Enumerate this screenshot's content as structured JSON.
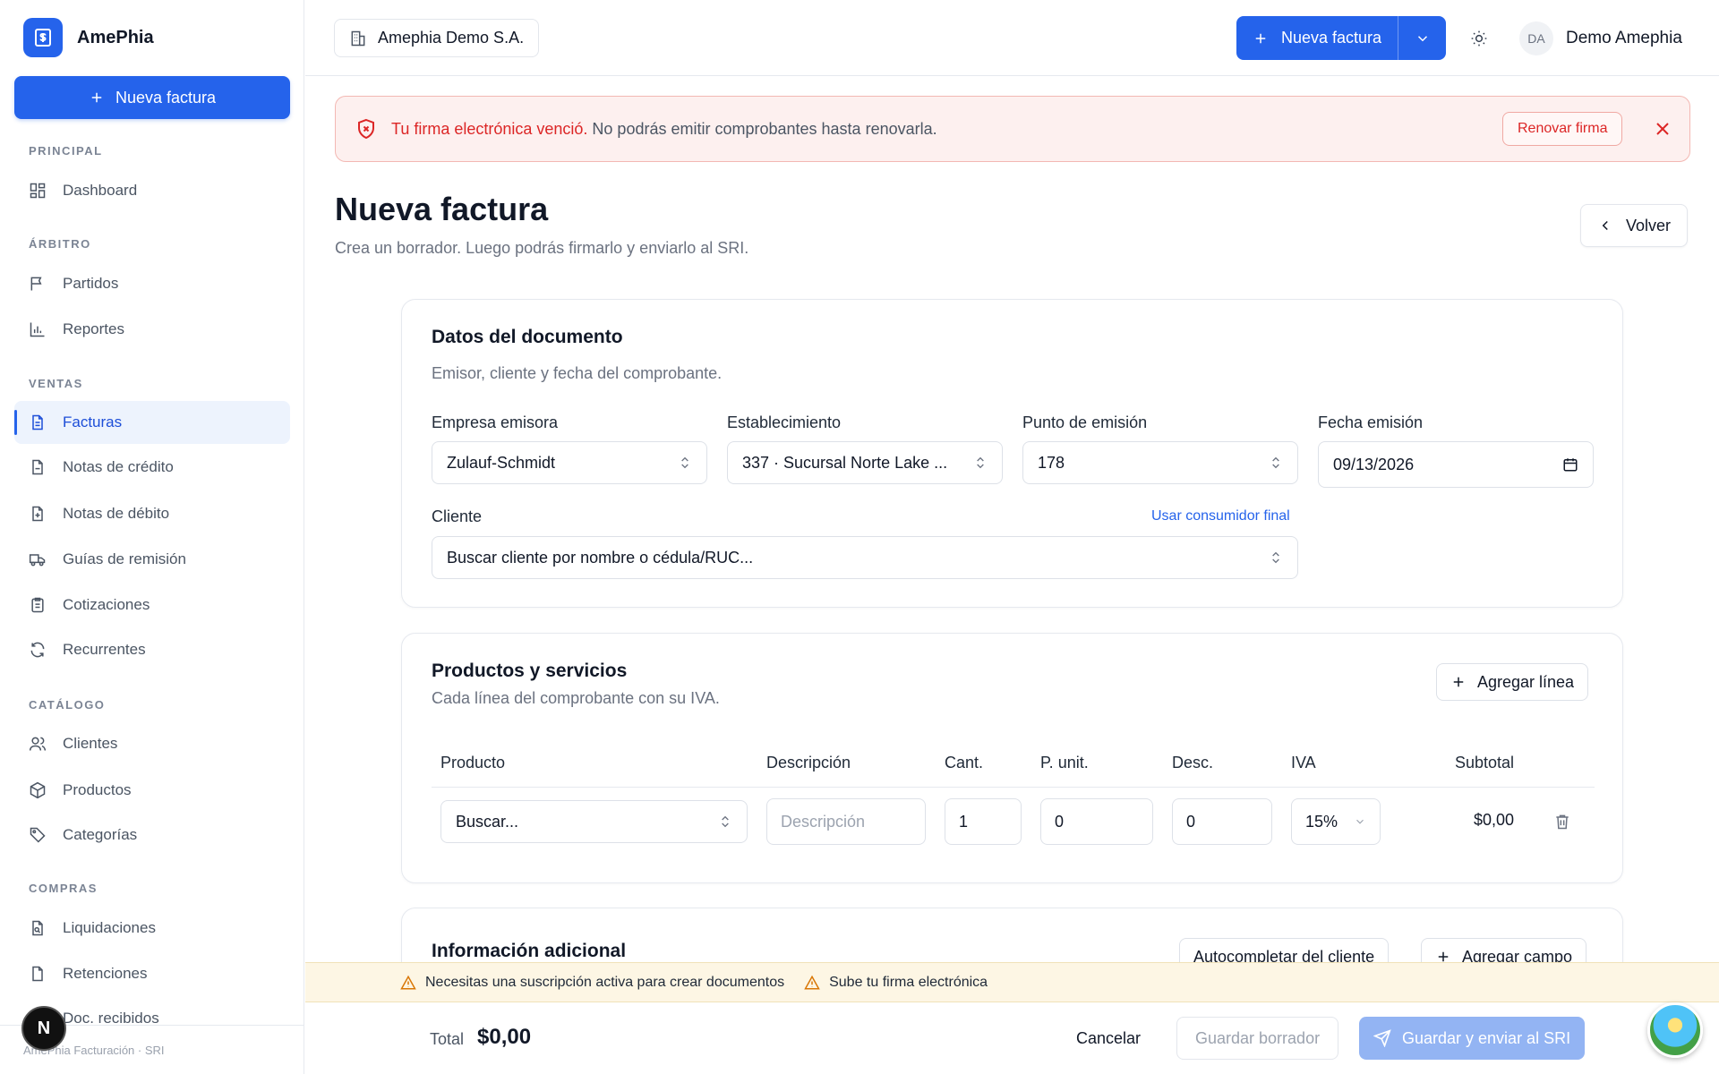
{
  "app": {
    "name": "AmePhia",
    "footer": "AmePhia Facturación · SRI"
  },
  "sidebar": {
    "cta": "Nueva factura",
    "sections": [
      {
        "title": "PRINCIPAL",
        "items": [
          {
            "label": "Dashboard",
            "icon": "grid-icon"
          }
        ]
      },
      {
        "title": "ÁRBITRO",
        "items": [
          {
            "label": "Partidos",
            "icon": "flag-icon"
          },
          {
            "label": "Reportes",
            "icon": "bar-chart-icon"
          }
        ]
      },
      {
        "title": "VENTAS",
        "items": [
          {
            "label": "Facturas",
            "icon": "document-icon",
            "active": true
          },
          {
            "label": "Notas de crédito",
            "icon": "file-minus-icon"
          },
          {
            "label": "Notas de débito",
            "icon": "file-plus-icon"
          },
          {
            "label": "Guías de remisión",
            "icon": "truck-icon"
          },
          {
            "label": "Cotizaciones",
            "icon": "clipboard-icon"
          },
          {
            "label": "Recurrentes",
            "icon": "refresh-icon"
          }
        ]
      },
      {
        "title": "CATÁLOGO",
        "items": [
          {
            "label": "Clientes",
            "icon": "users-icon"
          },
          {
            "label": "Productos",
            "icon": "package-icon"
          },
          {
            "label": "Categorías",
            "icon": "tag-icon"
          }
        ]
      },
      {
        "title": "COMPRAS",
        "items": [
          {
            "label": "Liquidaciones",
            "icon": "file-search-icon"
          },
          {
            "label": "Retenciones",
            "icon": "file-icon"
          },
          {
            "label": "Doc. recibidos",
            "icon": "inbox-icon"
          }
        ]
      }
    ],
    "badge": "N"
  },
  "header": {
    "company": "Amephia Demo S.A.",
    "new_invoice": "Nueva factura",
    "user_initials": "DA",
    "user_name": "Demo Amephia"
  },
  "alert": {
    "strong": "Tu firma electrónica venció.",
    "text": " No podrás emitir comprobantes hasta renovarla.",
    "action": "Renovar firma",
    "color": "#dc2626"
  },
  "page": {
    "title": "Nueva factura",
    "subtitle": "Crea un borrador. Luego podrás firmarlo y enviarlo al SRI.",
    "back": "Volver"
  },
  "document_card": {
    "title": "Datos del documento",
    "subtitle": "Emisor, cliente y fecha del comprobante.",
    "fields": {
      "empresa_label": "Empresa emisora",
      "empresa_value": "Zulauf-Schmidt",
      "establecimiento_label": "Establecimiento",
      "establecimiento_value": "337 · Sucursal Norte Lake ...",
      "punto_label": "Punto de emisión",
      "punto_value": "178",
      "fecha_label": "Fecha emisión",
      "fecha_value": "09/13/2026",
      "cliente_label": "Cliente",
      "cliente_link": "Usar consumidor final",
      "cliente_placeholder": "Buscar cliente por nombre o cédula/RUC..."
    }
  },
  "products_card": {
    "title": "Productos y servicios",
    "subtitle": "Cada línea del comprobante con su IVA.",
    "add_line": "Agregar línea",
    "columns": [
      "Producto",
      "Descripción",
      "Cant.",
      "P. unit.",
      "Desc.",
      "IVA",
      "Subtotal"
    ],
    "row": {
      "producto": "Buscar...",
      "descripcion_placeholder": "Descripción",
      "cantidad": "1",
      "precio": "0",
      "descuento": "0",
      "iva": "15%",
      "subtotal": "$0,00"
    }
  },
  "additional_card": {
    "title": "Información adicional",
    "autocomplete": "Autocompletar del cliente",
    "add_field": "Agregar campo"
  },
  "warnings": [
    "Necesitas una suscripción activa para crear documentos",
    "Sube tu firma electrónica"
  ],
  "footer_bar": {
    "total_label": "Total",
    "total_value": "$0,00",
    "cancel": "Cancelar",
    "draft": "Guardar borrador",
    "send": "Guardar y enviar al SRI"
  },
  "colors": {
    "accent": "#2563eb",
    "danger": "#dc2626",
    "warning_bg": "#fdf6e4"
  }
}
